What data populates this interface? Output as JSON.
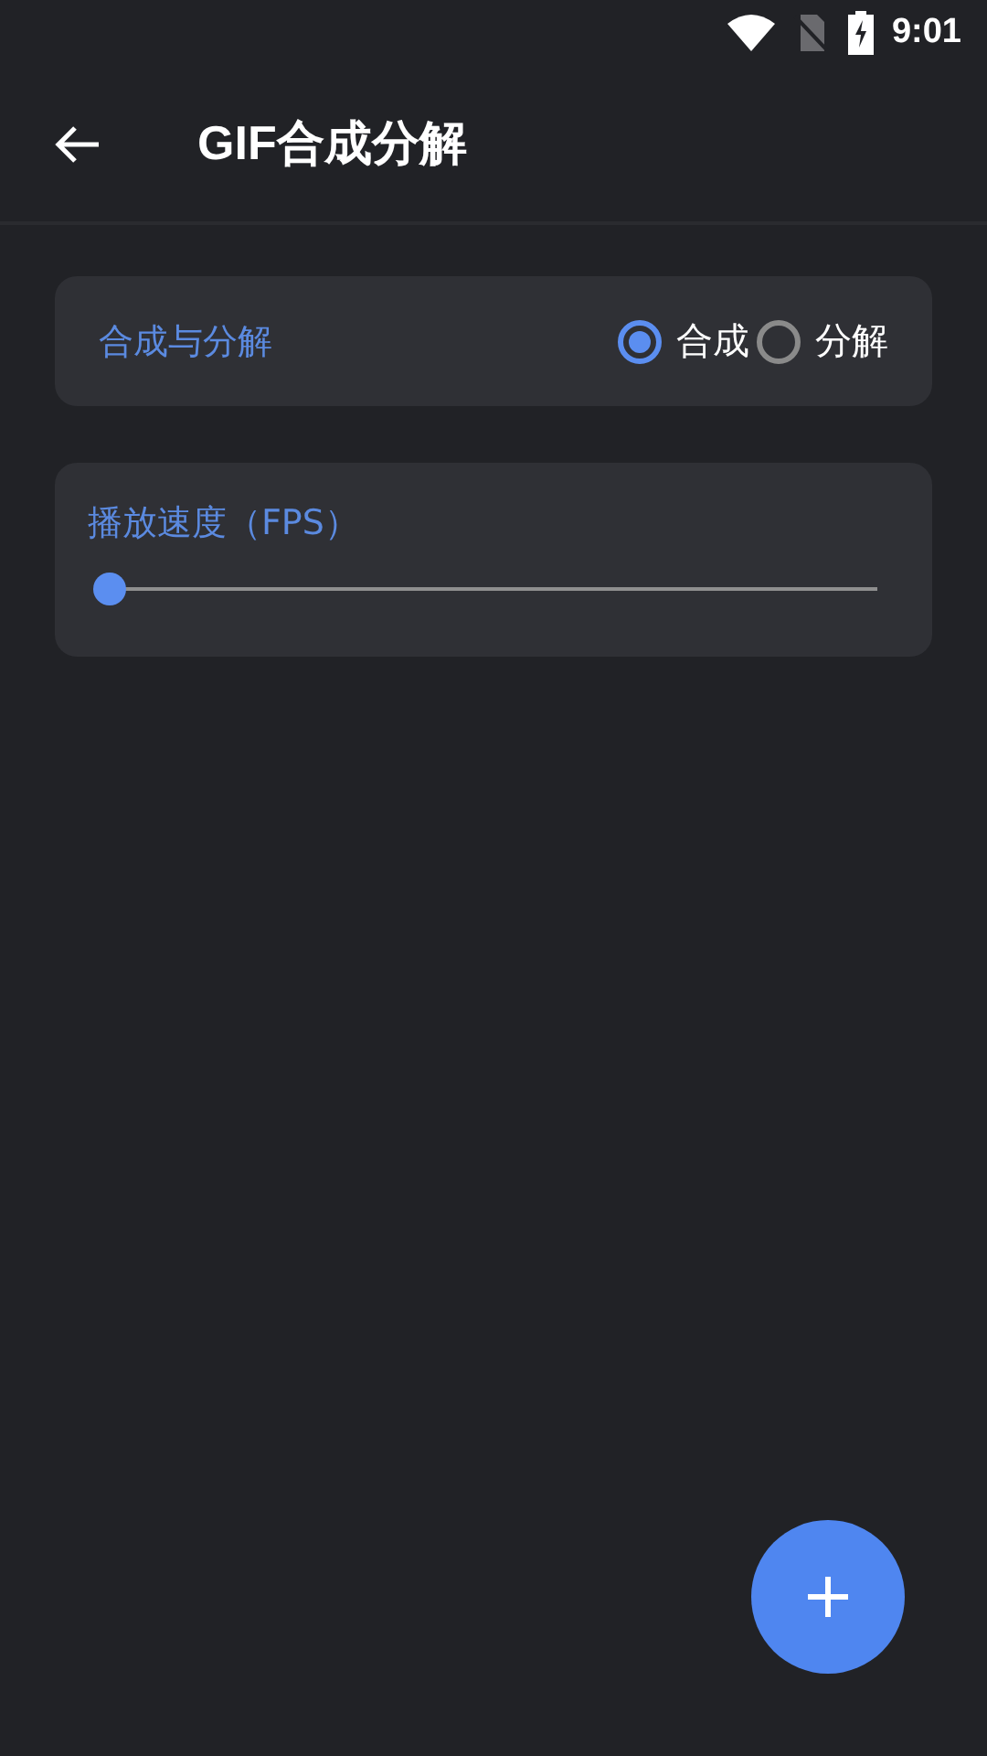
{
  "status_bar": {
    "time": "9:01"
  },
  "app_bar": {
    "title": "GIF合成分解"
  },
  "mode_card": {
    "label": "合成与分解",
    "options": [
      {
        "label": "合成",
        "selected": true
      },
      {
        "label": "分解",
        "selected": false
      }
    ]
  },
  "speed_card": {
    "label": "播放速度（FPS）",
    "slider": {
      "level": 0
    }
  }
}
